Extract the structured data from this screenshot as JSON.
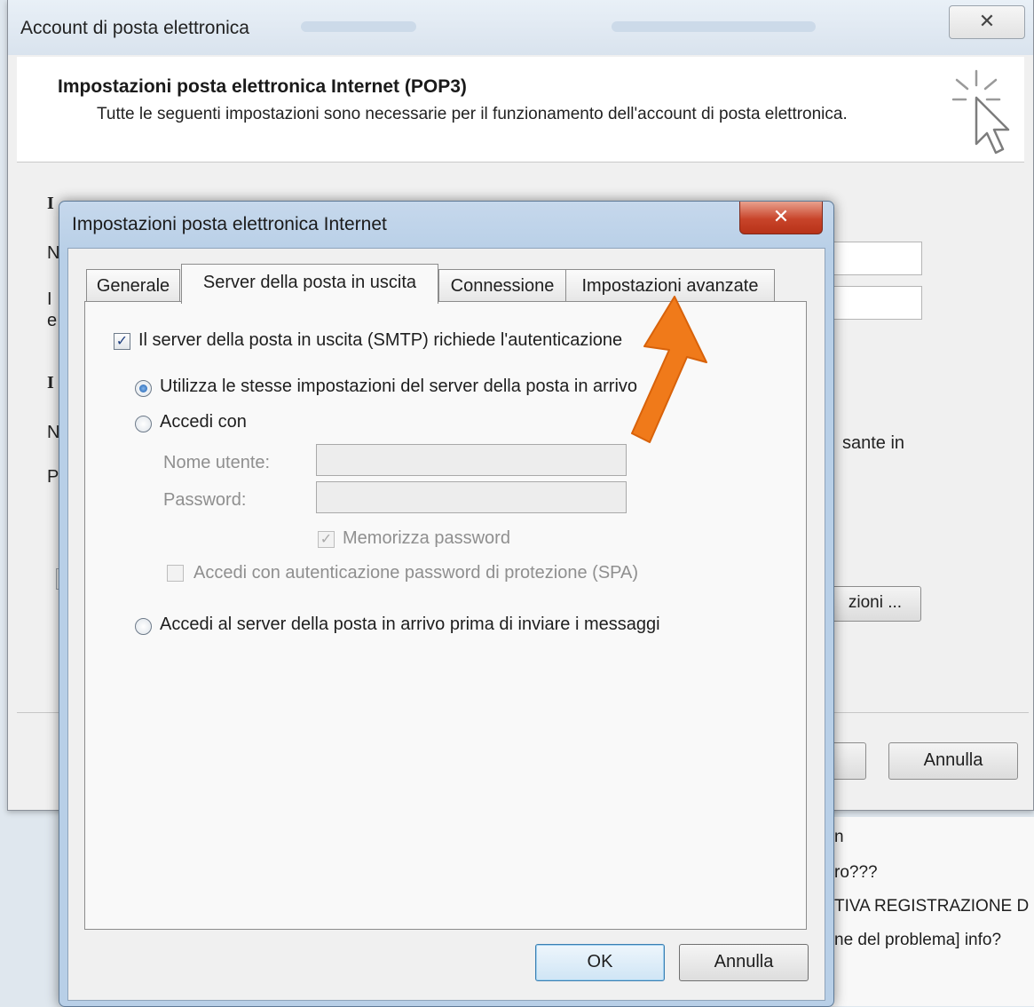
{
  "bg_window": {
    "title": "Account di posta elettronica",
    "close_glyph": "✕",
    "header_title": "Impostazioni posta elettronica Internet (POP3)",
    "header_desc": "Tutte le seguenti impostazioni sono necessarie per il funzionamento dell'account di posta elettronica.",
    "side_text": "sante in",
    "more_settings_label": "zioni ...",
    "annulla_label": "Annulla",
    "left_fragments": [
      "I",
      "N",
      "I",
      "e",
      "I",
      "N",
      "P"
    ]
  },
  "background_list": {
    "rows": [
      "n",
      "ro???",
      "TIVA REGISTRAZIONE D",
      "ne del problema] info?"
    ]
  },
  "dialog": {
    "title": "Impostazioni posta elettronica Internet",
    "close_glyph": "✕",
    "tabs": [
      {
        "label": "Generale"
      },
      {
        "label": "Server della posta in uscita"
      },
      {
        "label": "Connessione"
      },
      {
        "label": "Impostazioni avanzate"
      }
    ],
    "active_tab": "Server della posta in uscita",
    "smtp_auth": {
      "label": "Il server della posta in uscita (SMTP) richiede l'autenticazione",
      "checked": true
    },
    "radio_same": {
      "label": "Utilizza le stesse impostazioni del server della posta in arrivo",
      "selected": true
    },
    "radio_login": {
      "label": "Accedi con",
      "selected": false
    },
    "username": {
      "label": "Nome utente:",
      "value": ""
    },
    "password": {
      "label": "Password:",
      "value": ""
    },
    "remember_password": {
      "label": "Memorizza password",
      "checked": true,
      "disabled": true
    },
    "spa": {
      "label": "Accedi con autenticazione password di protezione (SPA)",
      "checked": false,
      "disabled": true
    },
    "radio_incoming_first": {
      "label": "Accedi al server della posta in arrivo prima di inviare i messaggi",
      "selected": false
    },
    "ok_label": "OK",
    "cancel_label": "Annulla"
  },
  "annotation": {
    "arrow_color": "#f07a1a",
    "points_to": "Impostazioni avanzate"
  }
}
